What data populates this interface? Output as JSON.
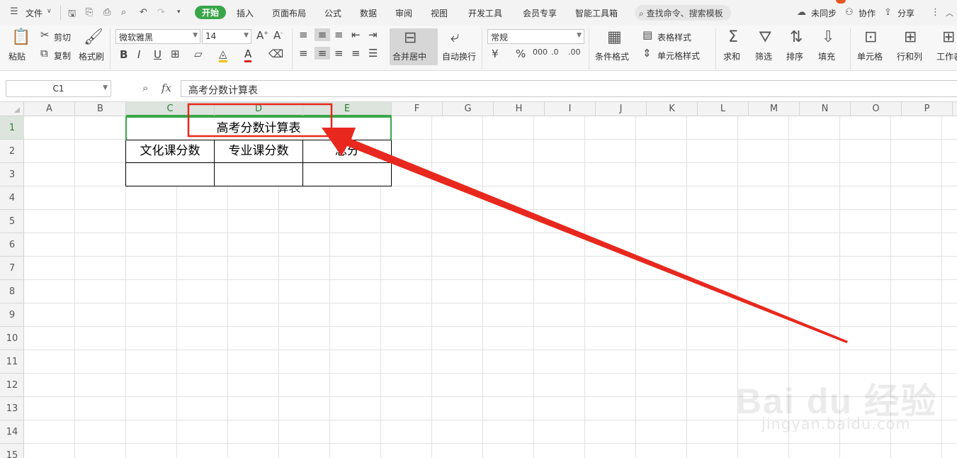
{
  "menu": {
    "file_label": "文件",
    "tabs": [
      "开始",
      "插入",
      "页面布局",
      "公式",
      "数据",
      "审阅",
      "视图",
      "开发工具",
      "会员专享",
      "智能工具箱"
    ],
    "search_placeholder": "查找命令、搜索模板",
    "unsynced": "未同步",
    "collab": "协作",
    "share": "分享"
  },
  "ribbon": {
    "paste": "粘贴",
    "cut": "剪切",
    "copy": "复制",
    "format_painter": "格式刷",
    "font_name": "微软雅黑",
    "font_size": "14",
    "merge_center": "合并居中",
    "wrap_text": "自动换行",
    "number_format": "常规",
    "conditional_format": "条件格式",
    "table_style": "表格样式",
    "cell_style": "单元格样式",
    "sum": "求和",
    "filter": "筛选",
    "sort": "排序",
    "fill": "填充",
    "cell": "单元格",
    "row_col": "行和列",
    "worksheet": "工作表"
  },
  "formula_bar": {
    "name_box": "C1",
    "fx": "fx",
    "content": "高考分数计算表"
  },
  "sheet": {
    "columns": [
      "A",
      "B",
      "C",
      "D",
      "E",
      "F",
      "G",
      "H",
      "I",
      "J",
      "K",
      "L",
      "M",
      "N",
      "O",
      "P"
    ],
    "rows": [
      "1",
      "2",
      "3",
      "4",
      "5",
      "6",
      "7",
      "8",
      "9",
      "10",
      "11",
      "12",
      "13",
      "14",
      "15"
    ],
    "title": "高考分数计算表",
    "headers": [
      "文化课分数",
      "专业课分数",
      "总分"
    ]
  },
  "watermark": {
    "brand": "Bai du 经验",
    "url": "jingyan.baidu.com"
  },
  "colors": {
    "accent_green": "#3aa64a",
    "annotation_red": "#e8281e"
  }
}
